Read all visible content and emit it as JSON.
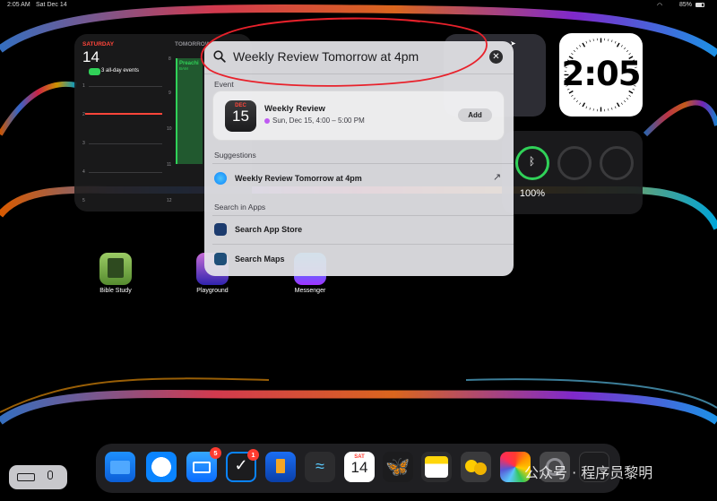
{
  "status_bar": {
    "time": "2:05 AM",
    "date": "Sat Dec 14",
    "battery": "85%"
  },
  "calendar_widget": {
    "today_label": "SATURDAY",
    "today_date": "14",
    "all_day": "3 all-day events",
    "tomorrow_label": "TOMORROW",
    "left_hours": [
      "1",
      "2",
      "3",
      "4",
      "5"
    ],
    "right_hours": [
      "8",
      "9",
      "10",
      "11",
      "12"
    ],
    "event_text": "Preachi",
    "event_sub": "BAM"
  },
  "clock_widget": {
    "time": "2:05"
  },
  "battery_widget": {
    "level": "100%",
    "level_fraction": 1.0
  },
  "home_apps": [
    {
      "label": "Bible Study"
    },
    {
      "label": "Playground"
    },
    {
      "label": "Messenger"
    }
  ],
  "spotlight": {
    "query": "Weekly Review Tomorrow at 4pm",
    "event_section": "Event",
    "event": {
      "month": "DEC",
      "day": "15",
      "title": "Weekly Review",
      "time": "Sun, Dec 15, 4:00 – 5:00 PM",
      "add_label": "Add"
    },
    "suggestions_section": "Suggestions",
    "suggestion": "Weekly Review Tomorrow at 4pm",
    "apps_section": "Search in Apps",
    "search_app_store": "Search App Store",
    "search_maps": "Search Maps"
  },
  "dock": {
    "mail_badge": "5",
    "reminders_badge": "1",
    "calendar_day_label": "SAT",
    "calendar_day": "14"
  },
  "watermark": "公众号 · 程序员黎明",
  "colors": {
    "accent_red": "#ff3b30",
    "green": "#30d158",
    "event_purple": "#bf5af2",
    "annotation_red": "#e8212b"
  }
}
